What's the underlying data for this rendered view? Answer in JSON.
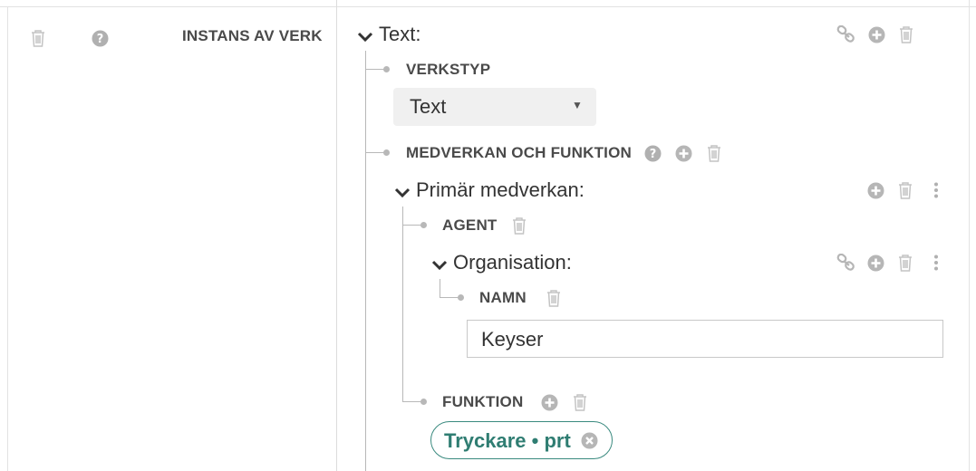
{
  "left_panel": {
    "row_label": "INSTANS AV VERK"
  },
  "work": {
    "title": "Text:",
    "work_type": {
      "label": "VERKSTYP",
      "selected": "Text",
      "arrow": "▼"
    },
    "contribution": {
      "label": "MEDVERKAN OCH FUNKTION",
      "primary": {
        "title": "Primär medverkan:",
        "agent": {
          "label": "AGENT",
          "organisation": {
            "title": "Organisation:",
            "name": {
              "label": "NAMN",
              "value": "Keyser"
            }
          }
        },
        "function": {
          "label": "FUNKTION",
          "tag": "Tryckare • prt"
        }
      }
    }
  },
  "icons": {
    "trash": "trash-icon",
    "help": "question-circle-icon",
    "add": "plus-circle-icon",
    "link": "link-icon",
    "more": "vertical-ellipsis-icon",
    "collapse": "chevron-down-icon",
    "remove": "times-circle-icon"
  },
  "colors": {
    "icon": "#bdbdbd",
    "tag": "#2f7d72",
    "tree_line": "#b8b8b8"
  }
}
